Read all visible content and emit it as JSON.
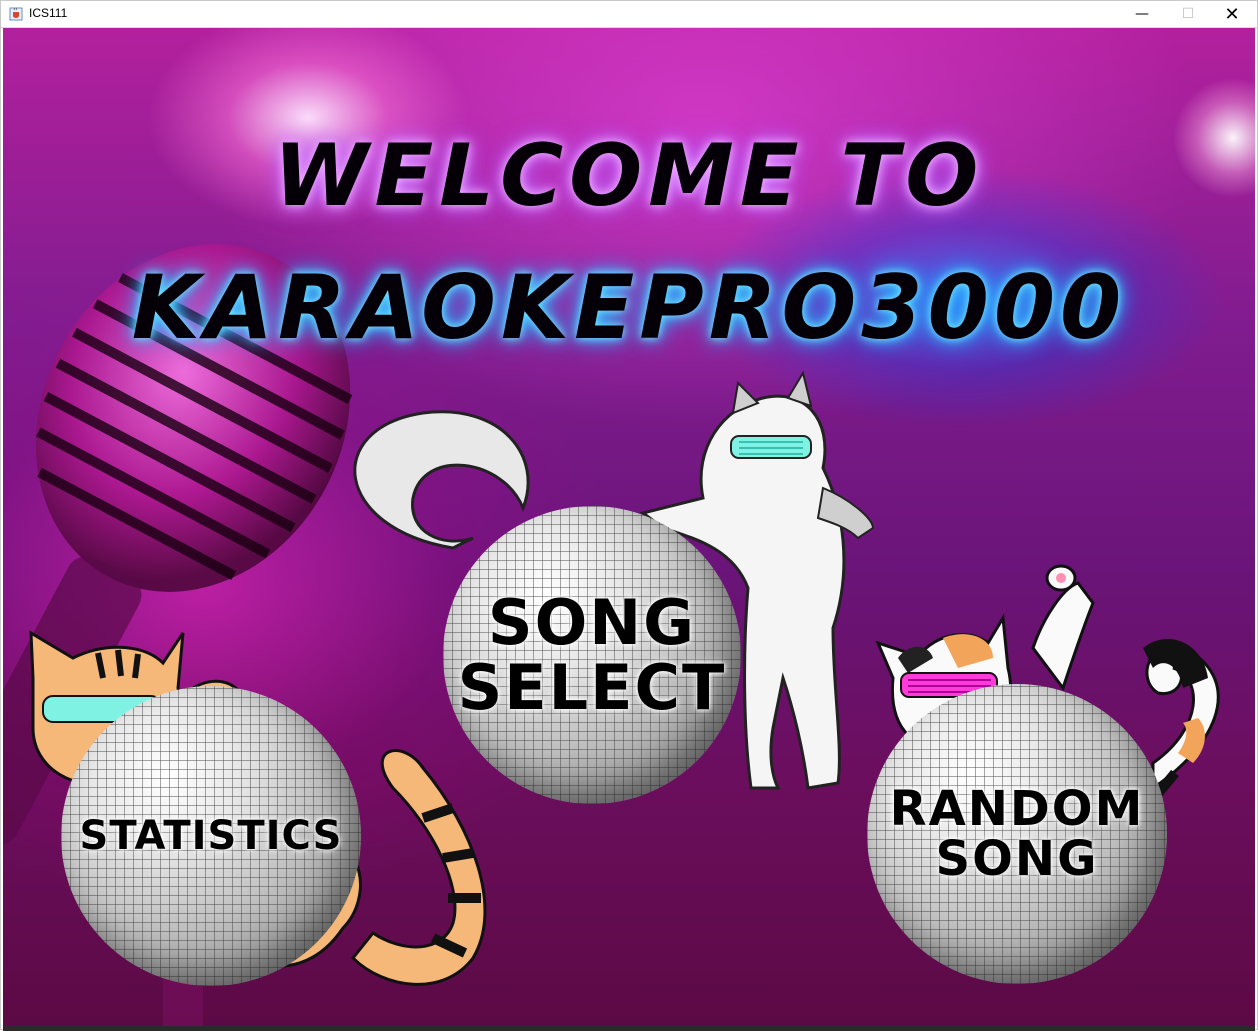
{
  "window": {
    "title": "ICS111",
    "min_glyph": "—",
    "max_glyph": "☐",
    "close_glyph": "✕"
  },
  "headline": {
    "line1": "WELCOME TO",
    "line2": "KARAOKEPRO3000"
  },
  "buttons": {
    "song_select": [
      "SONG",
      "SELECT"
    ],
    "statistics": [
      "STATISTICS"
    ],
    "random_song": [
      "RANDOM",
      "SONG"
    ]
  },
  "colors": {
    "title_glow": "#d67bff",
    "app_name_glow": "#31c7ff",
    "background": "#801c8f"
  },
  "icons": {
    "app": "java-cup-icon",
    "microphone": "microphone-illustration",
    "cats": [
      "tabby-cat-with-shutter-shades",
      "white-gray-cat-with-shutter-shades",
      "calico-cat-with-shutter-shades"
    ]
  }
}
